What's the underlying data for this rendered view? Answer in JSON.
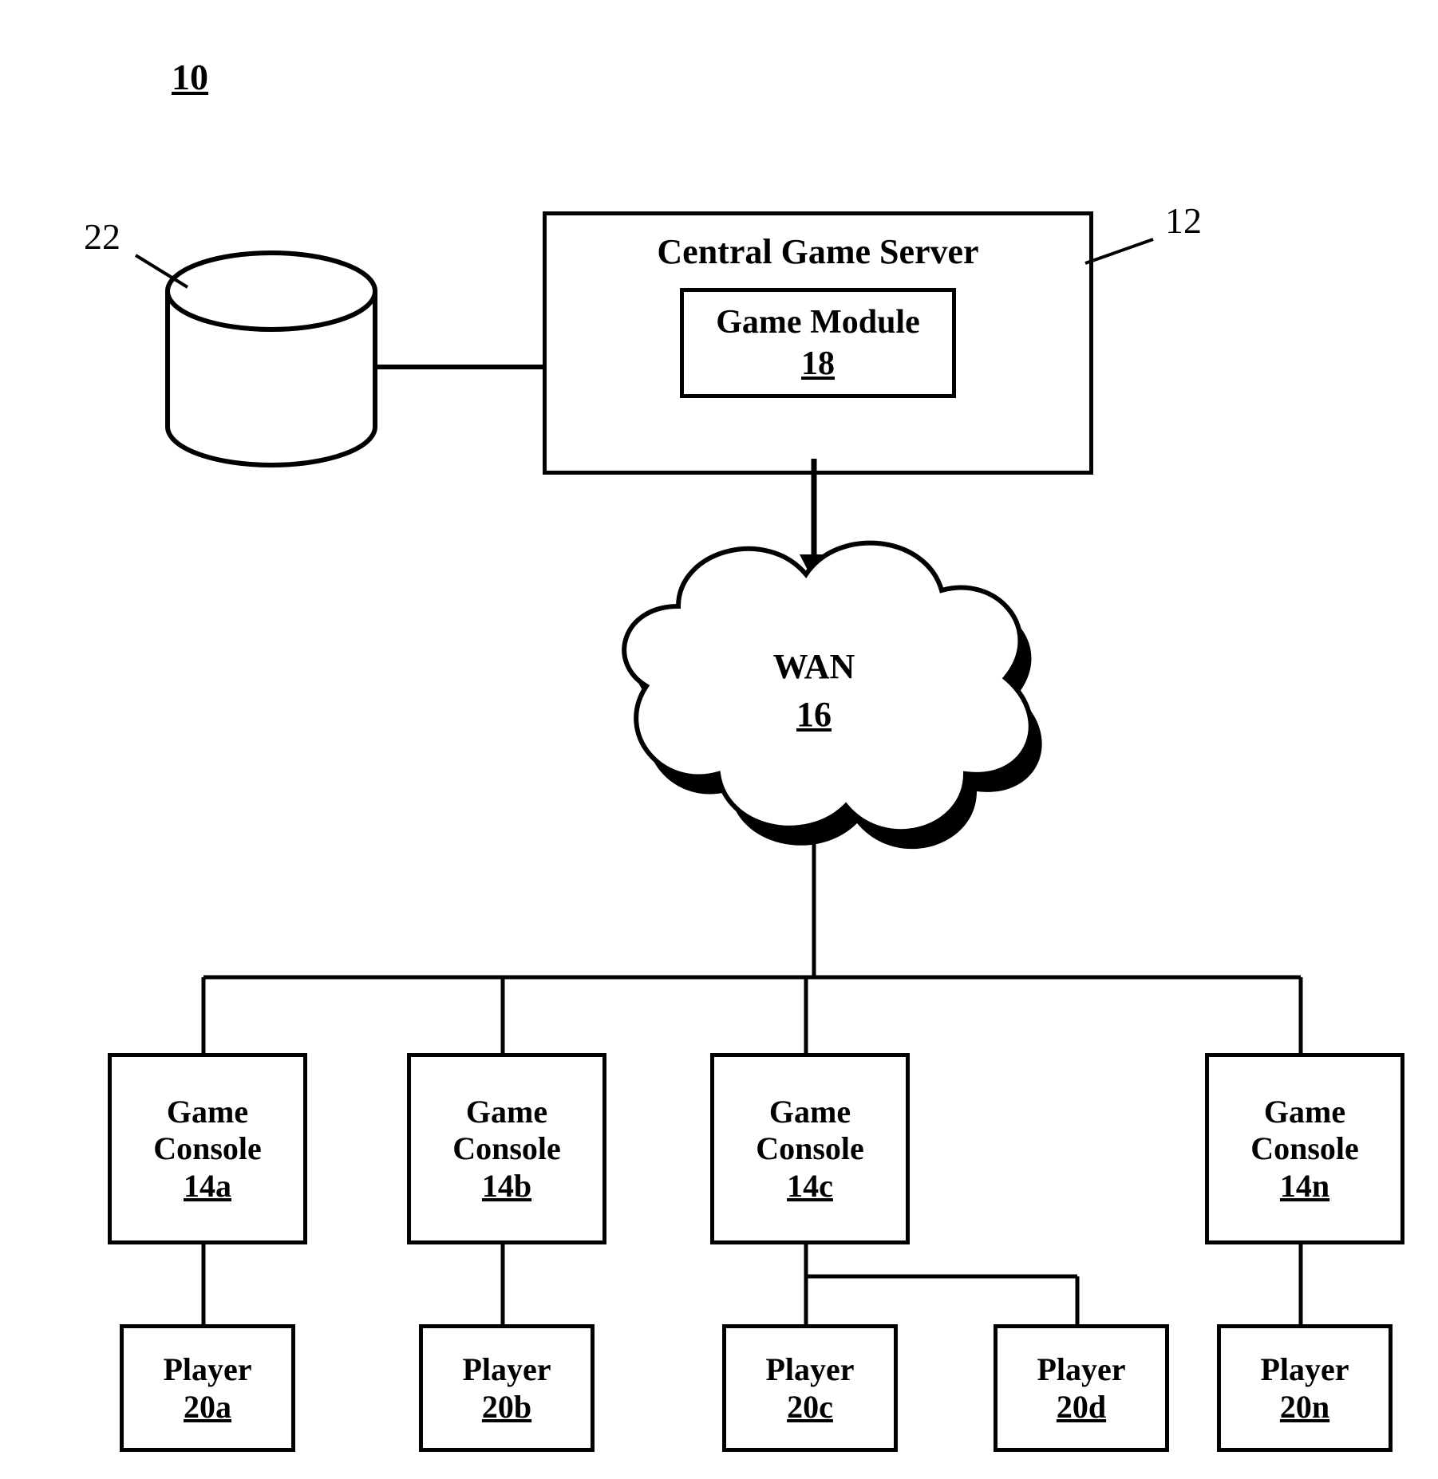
{
  "figure_id": "10",
  "refs": {
    "db": "22",
    "server": "12"
  },
  "server": {
    "title": "Central Game Server",
    "module_name": "Game Module",
    "module_ref": "18"
  },
  "wan": {
    "name": "WAN",
    "ref": "16"
  },
  "consoles": {
    "name": "Game\nConsole",
    "a": "14a",
    "b": "14b",
    "c": "14c",
    "n": "14n"
  },
  "players": {
    "name": "Player",
    "a": "20a",
    "b": "20b",
    "c": "20c",
    "d": "20d",
    "n": "20n"
  }
}
